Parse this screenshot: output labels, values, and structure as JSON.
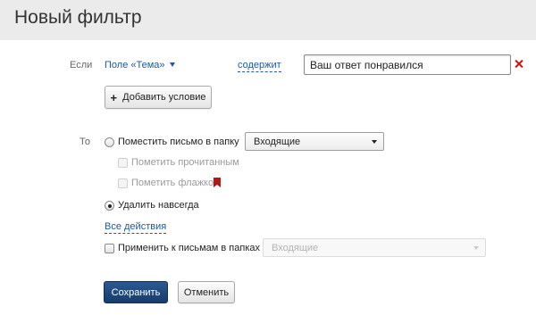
{
  "header": {
    "title": "Новый фильтр"
  },
  "condition": {
    "label": "Если",
    "field": "Поле «Тема»",
    "operator": "содержит",
    "value": "Ваш ответ понравился",
    "add_condition_label": "Добавить условие"
  },
  "actions": {
    "label": "То",
    "move_to_folder": {
      "label": "Поместить письмо в папку",
      "selected": false,
      "folder": "Входящие"
    },
    "mark_read": {
      "label": "Пометить прочитанным",
      "checked": false,
      "disabled": true
    },
    "mark_flag": {
      "label": "Пометить флажком",
      "checked": false,
      "disabled": true
    },
    "delete_forever": {
      "label": "Удалить навсегда",
      "selected": true
    },
    "all_actions_link": "Все действия"
  },
  "apply_to_folders": {
    "label": "Применить к письмам в папках",
    "checked": false,
    "folder": "Входящие"
  },
  "footer": {
    "save_label": "Сохранить",
    "cancel_label": "Отменить"
  },
  "colors": {
    "header_bg": "#ebebeb",
    "link": "#1a5aa1",
    "primary_button": "#1f4a7c",
    "remove_icon": "#c81414",
    "flag_icon": "#b51818"
  }
}
